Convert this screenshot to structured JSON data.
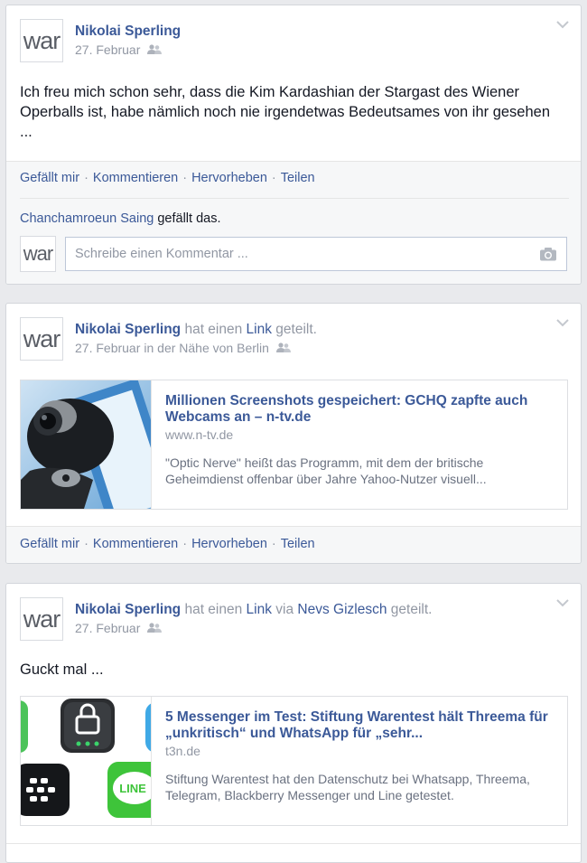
{
  "posts": [
    {
      "avatar": "war",
      "author": "Nikolai Sperling",
      "date": "27. Februar",
      "text": "Ich freu mich schon sehr, dass die Kim Kardashian der Stargast des Wiener Operballs ist, habe nämlich noch nie irgendetwas Bedeutsames von ihr gesehen ...",
      "actions": [
        "Gefällt mir",
        "Kommentieren",
        "Hervorheben",
        "Teilen"
      ],
      "likes_name": "Chanchamroeun Saing",
      "likes_suffix": " gefällt das.",
      "comment_avatar": "war",
      "comment_placeholder": "Schreibe einen Kommentar ..."
    },
    {
      "avatar": "war",
      "author": "Nikolai Sperling",
      "verb_a": " hat einen ",
      "link_word": "Link",
      "verb_b": " geteilt.",
      "date": "27. Februar",
      "location": "in der Nähe von Berlin",
      "link_title": "Millionen Screenshots gespeichert: GCHQ zapfte auch Webcams an – n-tv.de",
      "link_domain": "www.n-tv.de",
      "link_desc": "\"Optic Nerve\" heißt das Programm, mit dem der britische Geheimdienst offenbar über Jahre Yahoo-Nutzer visuell...",
      "actions": [
        "Gefällt mir",
        "Kommentieren",
        "Hervorheben",
        "Teilen"
      ]
    },
    {
      "avatar": "war",
      "author": "Nikolai Sperling",
      "verb_a": " hat einen ",
      "link_word": "Link",
      "verb_via": " via ",
      "via_name": "Nevs Gizlesch",
      "verb_b": " geteilt.",
      "date": "27. Februar",
      "text": "Guckt mal ...",
      "link_title": "5 Messenger im Test: Stiftung Warentest hält Threema für „unkritisch“ und WhatsApp für „sehr...",
      "link_domain": "t3n.de",
      "link_desc": "Stiftung Warentest hat den Datenschutz bei Whatsapp, Threema, Telegram, Blackberry Messenger und Line getestet.",
      "thumb_line_label": "LINE"
    }
  ],
  "icons": {
    "friends": "friends-icon",
    "chevron": "chevron-down-icon",
    "camera": "camera-icon"
  },
  "colors": {
    "link_blue": "#3b5998",
    "meta_gray": "#9197a3",
    "page_bg": "#e9eaed"
  }
}
